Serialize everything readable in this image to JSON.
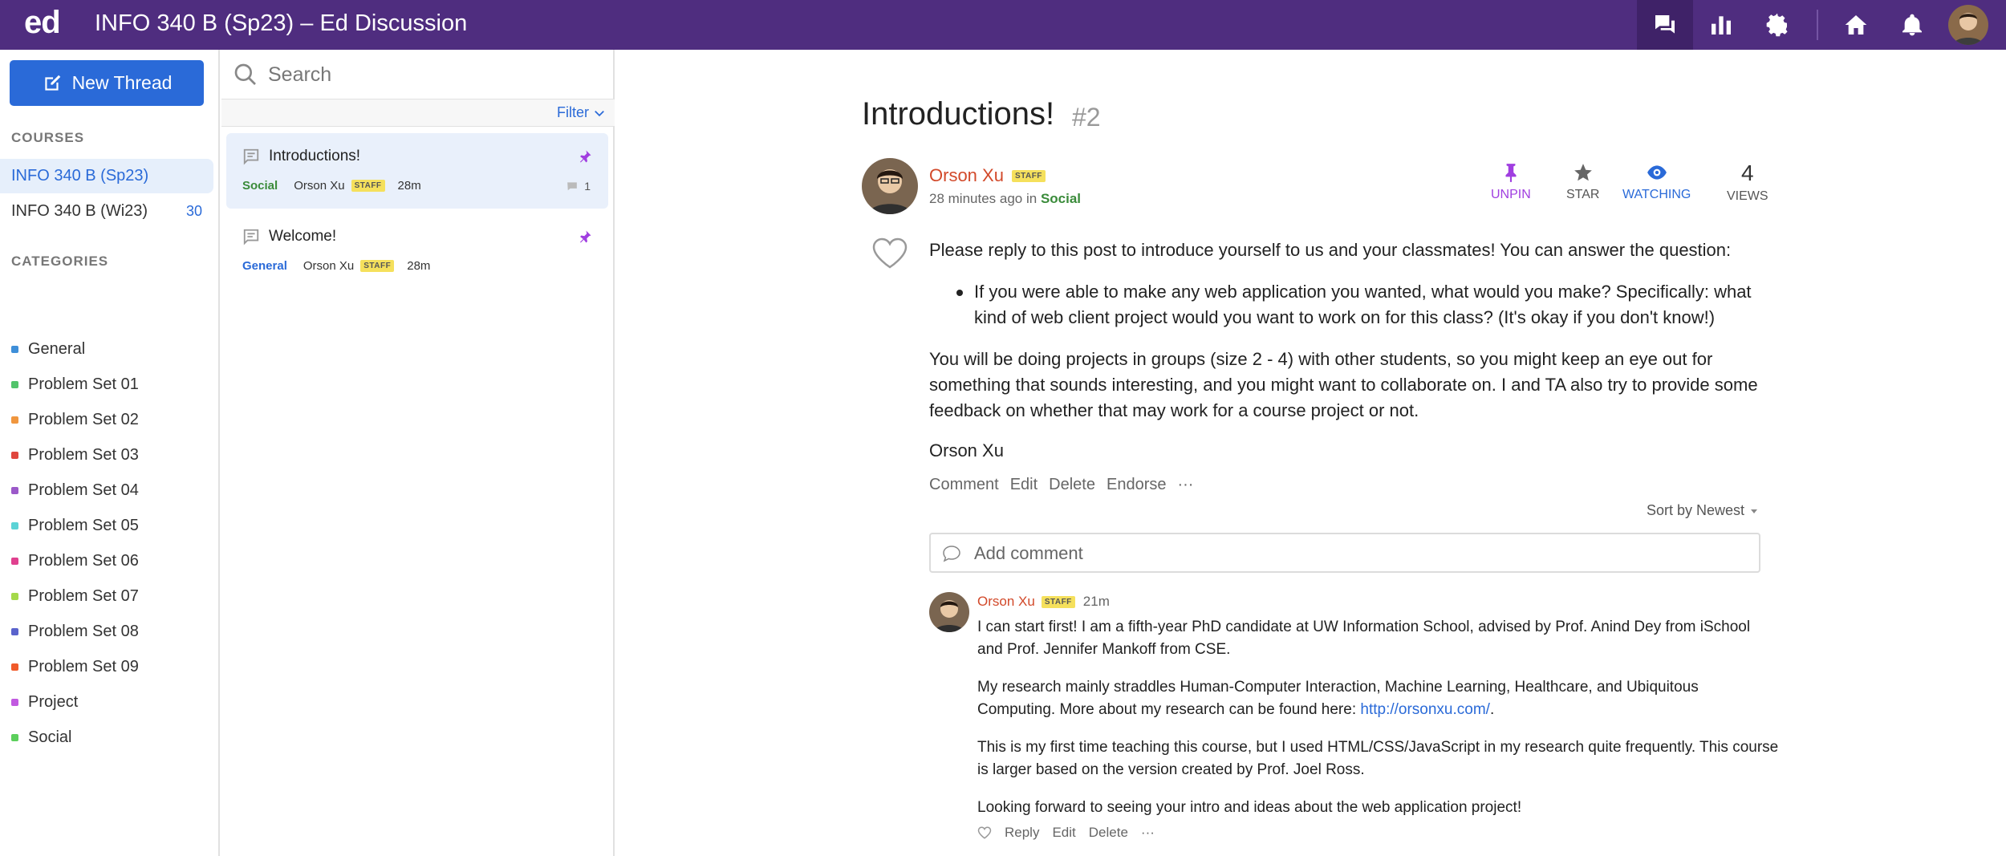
{
  "app": {
    "logo": "ed",
    "title": "INFO 340 B (Sp23) – Ed Discussion"
  },
  "topbar_icons": [
    "discussion-icon",
    "analytics-icon",
    "settings-icon",
    "home-icon",
    "notifications-icon",
    "user-avatar"
  ],
  "colors": {
    "header": "#4f2d7f",
    "accent": "#2a6ad8",
    "author": "#d2492a",
    "pin": "#a03ee0"
  },
  "sidebar": {
    "new_thread_label": "New Thread",
    "courses_heading": "COURSES",
    "courses": [
      {
        "name": "INFO 340 B (Sp23)",
        "count": ""
      },
      {
        "name": "INFO 340 B (Wi23)",
        "count": "30"
      }
    ],
    "categories_heading": "CATEGORIES",
    "categories": [
      {
        "name": "General",
        "color": "#3e8fd9"
      },
      {
        "name": "Problem Set 01",
        "color": "#52c46b"
      },
      {
        "name": "Problem Set 02",
        "color": "#f0963e"
      },
      {
        "name": "Problem Set 03",
        "color": "#e0463e"
      },
      {
        "name": "Problem Set 04",
        "color": "#9b59c9"
      },
      {
        "name": "Problem Set 05",
        "color": "#5bd3d6"
      },
      {
        "name": "Problem Set 06",
        "color": "#e0408f"
      },
      {
        "name": "Problem Set 07",
        "color": "#a4d94a"
      },
      {
        "name": "Problem Set 08",
        "color": "#5a63cc"
      },
      {
        "name": "Problem Set 09",
        "color": "#f05a2a"
      },
      {
        "name": "Project",
        "color": "#c159e0"
      },
      {
        "name": "Social",
        "color": "#5ccf5c"
      }
    ]
  },
  "threadlist": {
    "search_placeholder": "Search",
    "filter_label": "Filter",
    "threads": [
      {
        "title": "Introductions!",
        "category": "Social",
        "category_color": "#3a8b3a",
        "author": "Orson Xu",
        "badge": "STAFF",
        "time": "28m",
        "replies": "1"
      },
      {
        "title": "Welcome!",
        "category": "General",
        "category_color": "#2a6ad8",
        "author": "Orson Xu",
        "badge": "STAFF",
        "time": "28m",
        "replies": ""
      }
    ]
  },
  "post": {
    "title": "Introductions!",
    "number": "#2",
    "author": "Orson Xu",
    "badge": "STAFF",
    "time": "28 minutes ago in",
    "category": "Social",
    "actions": {
      "unpin": "UNPIN",
      "star": "STAR",
      "watching": "WATCHING",
      "views_count": "4",
      "views": "VIEWS"
    },
    "intro": "Please reply to this post to introduce yourself to us and your classmates! You can answer the question:",
    "bullet": "If you were able to make any web application you wanted, what would you make? Specifically: what kind of web client project would you want to work on for this class? (It's okay if you don't know!)",
    "paragraph": "You will be doing projects in groups (size 2 - 4) with other students, so you might keep an eye out for something that sounds interesting, and you might want to collaborate on. I and TA also try to provide some feedback on whether that may work for a course project or not.",
    "signature": "Orson Xu",
    "links": [
      "Comment",
      "Edit",
      "Delete",
      "Endorse",
      "···"
    ],
    "sort_label": "Sort by Newest",
    "comment_placeholder": "Add comment"
  },
  "comment": {
    "author": "Orson Xu",
    "badge": "STAFF",
    "time": "21m",
    "p1": "I can start first! I am a fifth-year PhD candidate at UW Information School, advised by Prof. Anind Dey from iSchool and Prof. Jennifer Mankoff from CSE.",
    "p2_text": "My research mainly straddles Human-Computer Interaction, Machine Learning, Healthcare, and Ubiquitous Computing. More about my research can be found here: ",
    "p2_link": "http://orsonxu.com/",
    "p2_end": ".",
    "p3": "This is my first time teaching this course, but I used HTML/CSS/JavaScript in my research quite frequently. This course is larger based on the version created by Prof. Joel Ross.",
    "p4": "Looking forward to seeing your intro and ideas about the web application project!",
    "reply": "Reply",
    "edit": "Edit",
    "delete": "Delete",
    "more": "···"
  }
}
